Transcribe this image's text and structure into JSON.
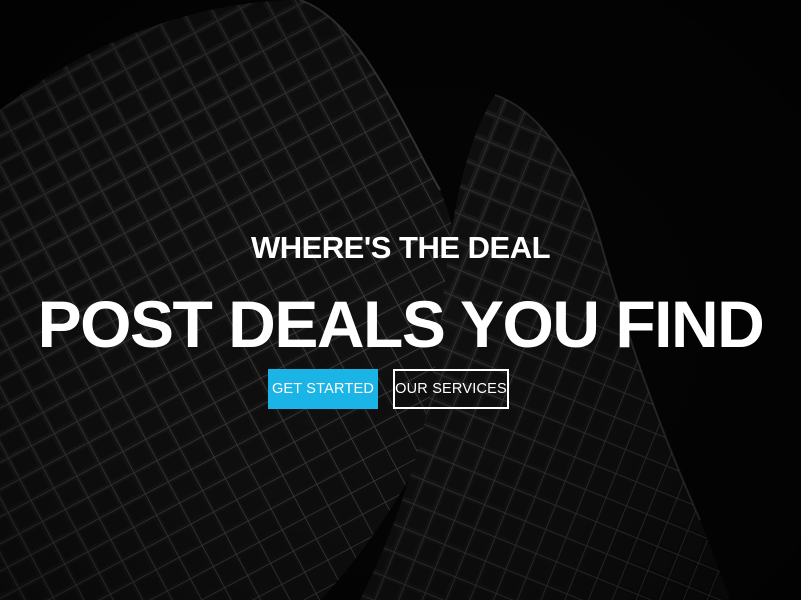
{
  "hero": {
    "subtitle": "WHERE'S THE DEAL",
    "title": "POST DEALS YOU FIND",
    "primary_button_label": "GET STARTED",
    "secondary_button_label": "OUR SERVICES",
    "background_image": "black-and-white skyscraper facade",
    "accent_color": "#1ab4e6"
  }
}
